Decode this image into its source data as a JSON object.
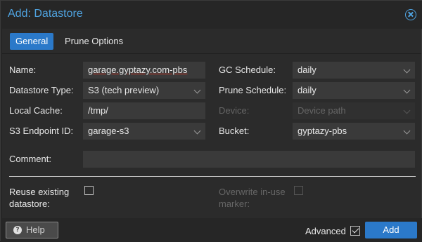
{
  "dialog": {
    "title": "Add: Datastore"
  },
  "tabs": [
    {
      "label": "General",
      "active": true
    },
    {
      "label": "Prune Options",
      "active": false
    }
  ],
  "form": {
    "name": {
      "label": "Name:",
      "value": "garage.gyptazy.com-pbs"
    },
    "datastore_type": {
      "label": "Datastore Type:",
      "value": "S3 (tech preview)"
    },
    "local_cache": {
      "label": "Local Cache:",
      "value": "/tmp/"
    },
    "s3_endpoint_id": {
      "label": "S3 Endpoint ID:",
      "value": "garage-s3"
    },
    "gc_schedule": {
      "label": "GC Schedule:",
      "value": "daily"
    },
    "prune_schedule": {
      "label": "Prune Schedule:",
      "value": "daily"
    },
    "device": {
      "label": "Device:",
      "placeholder": "Device path",
      "disabled": true
    },
    "bucket": {
      "label": "Bucket:",
      "value": "gyptazy-pbs"
    },
    "comment": {
      "label": "Comment:",
      "value": ""
    },
    "reuse_existing": {
      "label_line1": "Reuse existing",
      "label_line2": "datastore:",
      "checked": false
    },
    "overwrite_marker": {
      "label_line1": "Overwrite in-use",
      "label_line2": "marker:",
      "checked": false,
      "disabled": true
    }
  },
  "footer": {
    "help_label": "Help",
    "advanced_label": "Advanced",
    "advanced_checked": true,
    "add_label": "Add"
  },
  "colors": {
    "accent": "#2b79c9",
    "title": "#4fa3e0",
    "background": "#2b2b2b"
  }
}
